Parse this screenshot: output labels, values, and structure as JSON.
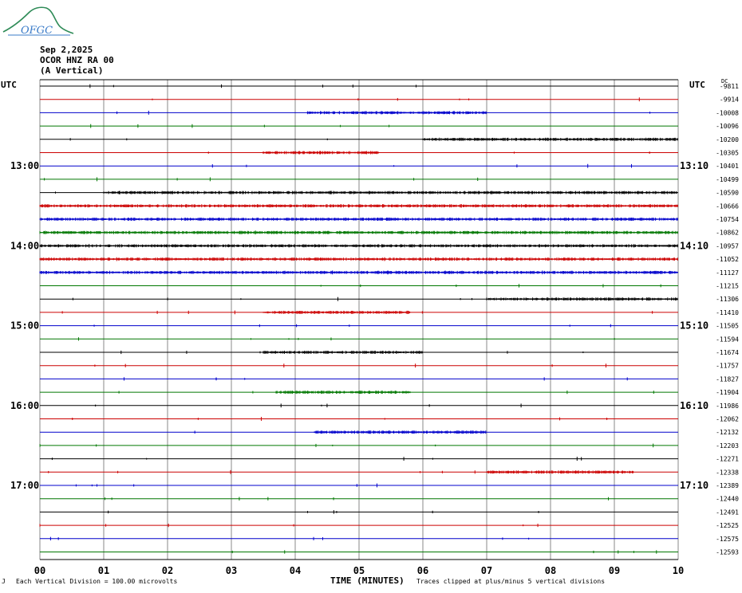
{
  "header": {
    "date": "Sep 2,2025",
    "station": "OCOR HNZ RA 00",
    "component": "(A Vertical)",
    "logo_text": "OFGC"
  },
  "corner": {
    "utc_left": "UTC",
    "utc_right": "UTC",
    "dc_label": "DC"
  },
  "footer": {
    "mark": "J",
    "scale_note": "Each Vertical Division =  100.00 microvolts",
    "x_axis_title": "TIME (MINUTES)",
    "clip_note": "Traces clipped at plus/minus 5 vertical divisions"
  },
  "colors": {
    "black": "#000000",
    "red": "#cc0000",
    "blue": "#0000cc",
    "green": "#007700",
    "grid": "#888888"
  },
  "chart_data": {
    "type": "line",
    "title": "",
    "xlabel": "TIME (MINUTES)",
    "ylabel": "",
    "x_ticks": [
      "00",
      "01",
      "02",
      "03",
      "04",
      "05",
      "06",
      "07",
      "08",
      "09",
      "10"
    ],
    "xlim": [
      0,
      10
    ],
    "trace_color_cycle": [
      "black",
      "red",
      "blue",
      "green"
    ],
    "left_time_labels": [
      {
        "row": 6,
        "text": "13:00"
      },
      {
        "row": 12,
        "text": "14:00"
      },
      {
        "row": 18,
        "text": "15:00"
      },
      {
        "row": 24,
        "text": "16:00"
      },
      {
        "row": 30,
        "text": "17:00"
      }
    ],
    "right_time_labels": [
      {
        "row": 6,
        "text": "13:10"
      },
      {
        "row": 12,
        "text": "14:10"
      },
      {
        "row": 18,
        "text": "15:10"
      },
      {
        "row": 24,
        "text": "16:10"
      },
      {
        "row": 30,
        "text": "17:10"
      }
    ],
    "dc_offsets": [
      "-9811",
      "-9914",
      "-10008",
      "-10096",
      "-10200",
      "-10305",
      "-10401",
      "-10499",
      "-10590",
      "-10666",
      "-10754",
      "-10862",
      "-10957",
      "-11052",
      "-11127",
      "-11215",
      "-11306",
      "-11410",
      "-11505",
      "-11594",
      "-11674",
      "-11757",
      "-11827",
      "-11904",
      "-11986",
      "-12062",
      "-12132",
      "-12203",
      "-12271",
      "-12338",
      "-12389",
      "-12440",
      "-12491",
      "-12525",
      "-12575",
      "-12593"
    ],
    "noisy_segments": [
      {
        "row": 2,
        "x": [
          4.2,
          7.0
        ]
      },
      {
        "row": 4,
        "x": [
          6.0,
          10.0
        ]
      },
      {
        "row": 5,
        "x": [
          3.5,
          5.3
        ]
      },
      {
        "row": 8,
        "x": [
          1.0,
          10.0
        ]
      },
      {
        "row": 9,
        "x": [
          0.0,
          10.0
        ]
      },
      {
        "row": 10,
        "x": [
          0.0,
          10.0
        ]
      },
      {
        "row": 11,
        "x": [
          0.0,
          10.0
        ]
      },
      {
        "row": 12,
        "x": [
          0.0,
          10.0
        ]
      },
      {
        "row": 13,
        "x": [
          0.0,
          10.0
        ]
      },
      {
        "row": 14,
        "x": [
          0.0,
          10.0
        ]
      },
      {
        "row": 16,
        "x": [
          7.0,
          10.0
        ]
      },
      {
        "row": 17,
        "x": [
          3.5,
          5.8
        ]
      },
      {
        "row": 20,
        "x": [
          3.5,
          6.0
        ]
      },
      {
        "row": 23,
        "x": [
          3.7,
          5.8
        ]
      },
      {
        "row": 26,
        "x": [
          4.3,
          7.0
        ]
      },
      {
        "row": 29,
        "x": [
          7.0,
          9.3
        ]
      }
    ]
  }
}
